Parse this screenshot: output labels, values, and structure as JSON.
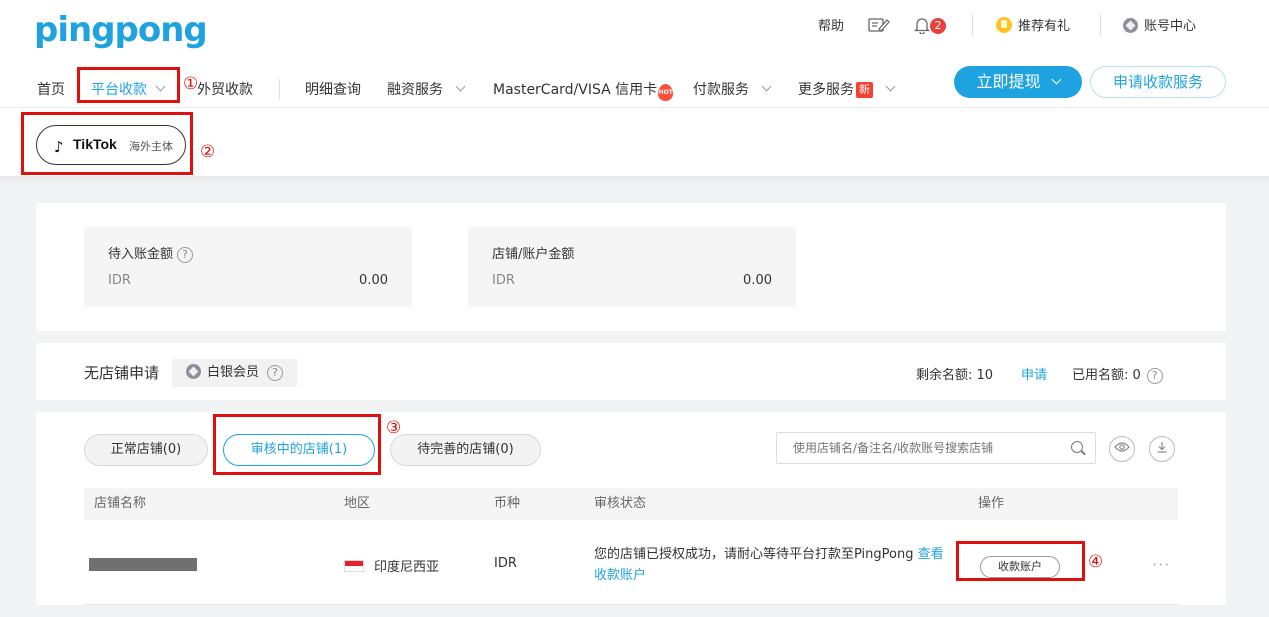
{
  "brand": {
    "logo": "pingpong"
  },
  "top_bar": {
    "help": "帮助",
    "notification_count": "2",
    "referral": "推荐有礼",
    "account_center": "账号中心"
  },
  "nav": {
    "home": "首页",
    "platform_collection": "平台收款",
    "trade_collection": "外贸收款",
    "details": "明细查询",
    "financing": "融资服务",
    "card": "MasterCard/VISA 信用卡",
    "hot_badge": "HOT",
    "payment": "付款服务",
    "more": "更多服务",
    "new_badge": "新"
  },
  "actions": {
    "withdraw": "立即提现",
    "apply_collection": "申请收款服务"
  },
  "platform_tab": {
    "name": "TikTok",
    "sub": "海外主体"
  },
  "balances": [
    {
      "label": "待入账金额",
      "currency": "IDR",
      "value": "0.00"
    },
    {
      "label": "店铺/账户金额",
      "currency": "IDR",
      "value": "0.00"
    }
  ],
  "quota": {
    "title": "无店铺申请",
    "member_level": "白银会员",
    "remaining_label": "剩余名额:",
    "remaining": "10",
    "apply_link": "申请",
    "used_label": "已用名额:",
    "used": "0"
  },
  "store_tabs": [
    {
      "label": "正常店铺(0)"
    },
    {
      "label": "审核中的店铺(1)"
    },
    {
      "label": "待完善的店铺(0)"
    }
  ],
  "search": {
    "placeholder": "使用店铺名/备注名/收款账号搜索店铺"
  },
  "table": {
    "headers": [
      "店铺名称",
      "地区",
      "币种",
      "审核状态",
      "操作"
    ],
    "row": {
      "region": "印度尼西亚",
      "currency": "IDR",
      "status_text": "您的店铺已授权成功，请耐心等待平台打款至PingPong",
      "status_link": "查看收款账户",
      "action": "收款账户"
    }
  },
  "annotations": [
    "①",
    "②",
    "③",
    "④"
  ],
  "colors": {
    "accent": "#1fa3e0",
    "annotation": "#e01010",
    "badge": "#e8413c"
  }
}
